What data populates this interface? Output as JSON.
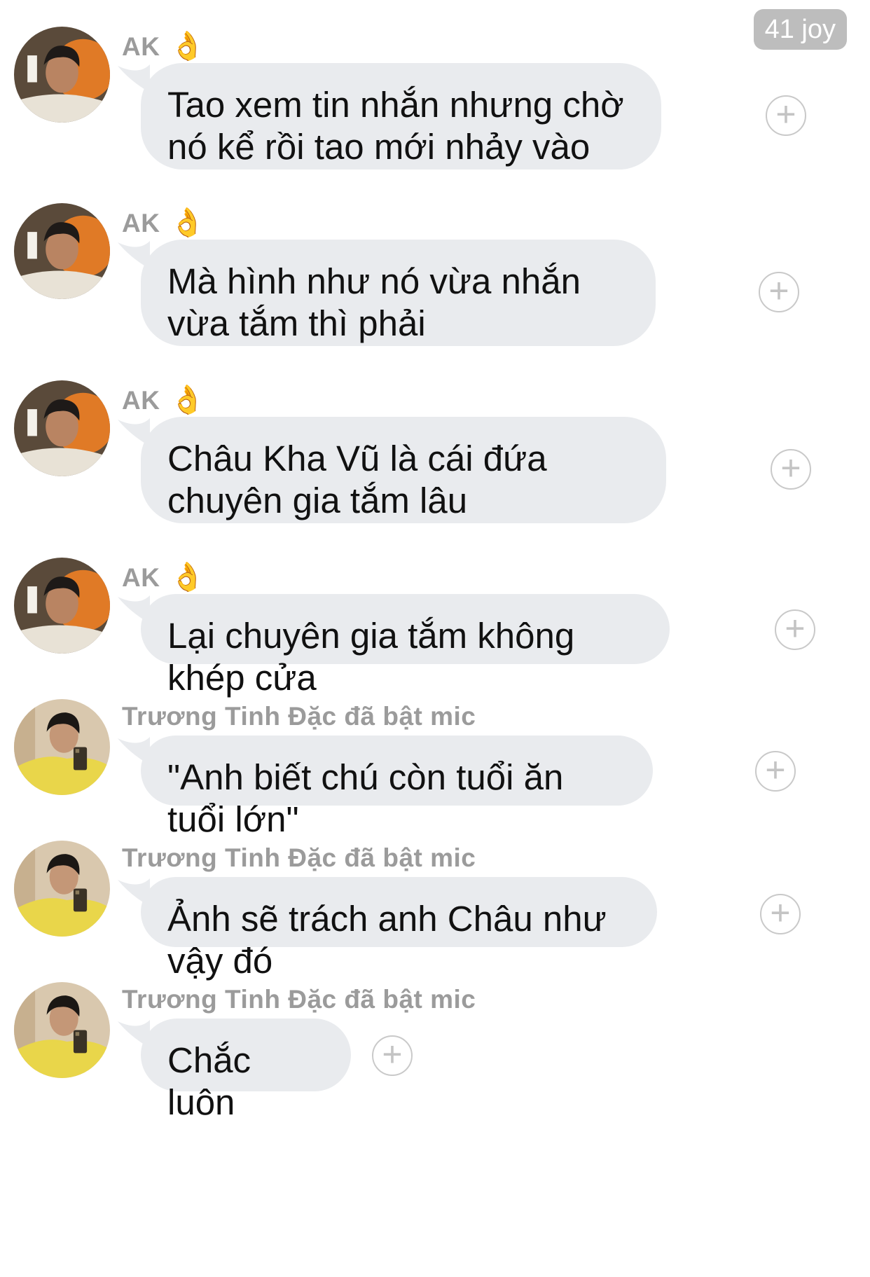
{
  "header": {
    "joy_badge": "41 joy"
  },
  "messages": [
    {
      "sender": "AK",
      "emoji": "👌",
      "text": "Tao xem tin nhắn nhưng chờ nó kể rồi tao mới nhảy vào"
    },
    {
      "sender": "AK",
      "emoji": "👌",
      "text": "Mà hình như nó vừa nhắn vừa tắm thì phải"
    },
    {
      "sender": "AK",
      "emoji": "👌",
      "text": "Châu Kha Vũ là cái đứa chuyên gia tắm lâu"
    },
    {
      "sender": "AK",
      "emoji": "👌",
      "text": "Lại chuyên gia tắm không khép cửa"
    },
    {
      "sender": "Trương Tinh Đặc đã bật mic",
      "emoji": "",
      "text": "\"Anh biết chú còn tuổi ăn tuổi lớn\""
    },
    {
      "sender": "Trương Tinh Đặc đã bật mic",
      "emoji": "",
      "text": "Ảnh sẽ trách anh Châu như vậy đó"
    },
    {
      "sender": "Trương Tinh Đặc đã bật mic",
      "emoji": "",
      "text": "Chắc luôn"
    }
  ],
  "icons": {
    "add": "plus-circle-icon"
  },
  "colors": {
    "bubble": "#e9ebee",
    "sender": "#9b9b9b",
    "badge": "#bdbdbd"
  }
}
